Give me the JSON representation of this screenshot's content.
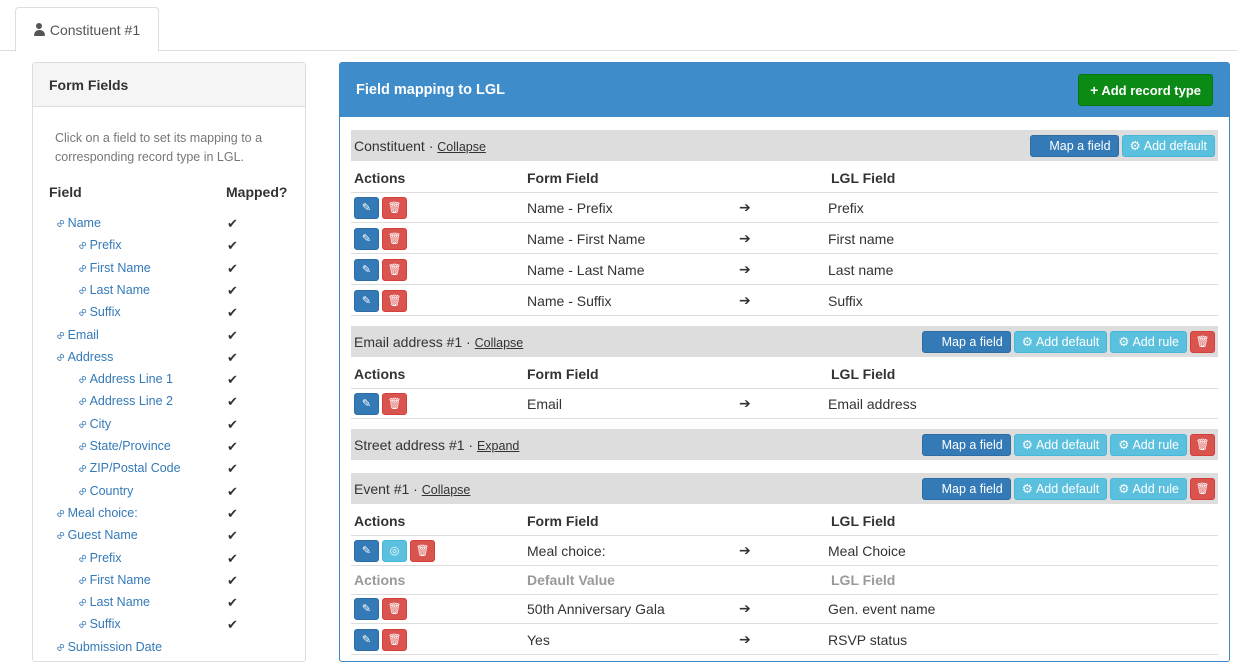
{
  "tab": {
    "label": "Constituent #1",
    "icon": "user-icon"
  },
  "left_panel": {
    "title": "Form Fields",
    "description": "Click on a field to set its mapping to a corresponding record type in LGL.",
    "col_field": "Field",
    "col_mapped": "Mapped?",
    "check_glyph": "✔",
    "fields": [
      {
        "label": "Name",
        "level": 0
      },
      {
        "label": "Prefix",
        "level": 1
      },
      {
        "label": "First Name",
        "level": 1
      },
      {
        "label": "Last Name",
        "level": 1
      },
      {
        "label": "Suffix",
        "level": 1
      },
      {
        "label": "Email",
        "level": 0
      },
      {
        "label": "Address",
        "level": 0
      },
      {
        "label": "Address Line 1",
        "level": 1
      },
      {
        "label": "Address Line 2",
        "level": 1
      },
      {
        "label": "City",
        "level": 1
      },
      {
        "label": "State/Province",
        "level": 1
      },
      {
        "label": "ZIP/Postal Code",
        "level": 1
      },
      {
        "label": "Country",
        "level": 1
      },
      {
        "label": "Meal choice:",
        "level": 0
      },
      {
        "label": "Guest Name",
        "level": 0
      },
      {
        "label": "Prefix",
        "level": 1
      },
      {
        "label": "First Name",
        "level": 1
      },
      {
        "label": "Last Name",
        "level": 1
      },
      {
        "label": "Suffix",
        "level": 1
      },
      {
        "label": "Submission Date",
        "level": 0
      }
    ]
  },
  "right_panel": {
    "title": "Field mapping to LGL",
    "add_record_label": "Add record type",
    "map_field_label": "Map a field",
    "add_default_label": "Add default",
    "add_rule_label": "Add rule",
    "col_actions": "Actions",
    "col_form_field": "Form Field",
    "col_lgl_field": "LGL Field",
    "col_default_value": "Default Value",
    "arrow_glyph": "➔",
    "sections": {
      "constituent": {
        "title": "Constituent",
        "toggle": "Collapse"
      },
      "email": {
        "title": "Email address #1",
        "toggle": "Collapse"
      },
      "street": {
        "title": "Street address #1",
        "toggle": "Expand"
      },
      "event": {
        "title": "Event #1",
        "toggle": "Collapse"
      }
    },
    "constituent_rows": [
      {
        "form": "Name - Prefix",
        "lgl": "Prefix"
      },
      {
        "form": "Name - First Name",
        "lgl": "First name"
      },
      {
        "form": "Name - Last Name",
        "lgl": "Last name"
      },
      {
        "form": "Name - Suffix",
        "lgl": "Suffix"
      }
    ],
    "email_rows": [
      {
        "form": "Email",
        "lgl": "Email address"
      }
    ],
    "event_rows": [
      {
        "form": "Meal choice:",
        "lgl": "Meal Choice"
      }
    ],
    "event_default_rows": [
      {
        "form": "50th Anniversary Gala",
        "lgl": "Gen. event name"
      },
      {
        "form": "Yes",
        "lgl": "RSVP status"
      }
    ]
  },
  "colors": {
    "primary": "#337ab7",
    "header_blue": "#3f8ccb",
    "success": "#0b8a16",
    "info": "#5bc0de",
    "danger": "#d9534f"
  }
}
